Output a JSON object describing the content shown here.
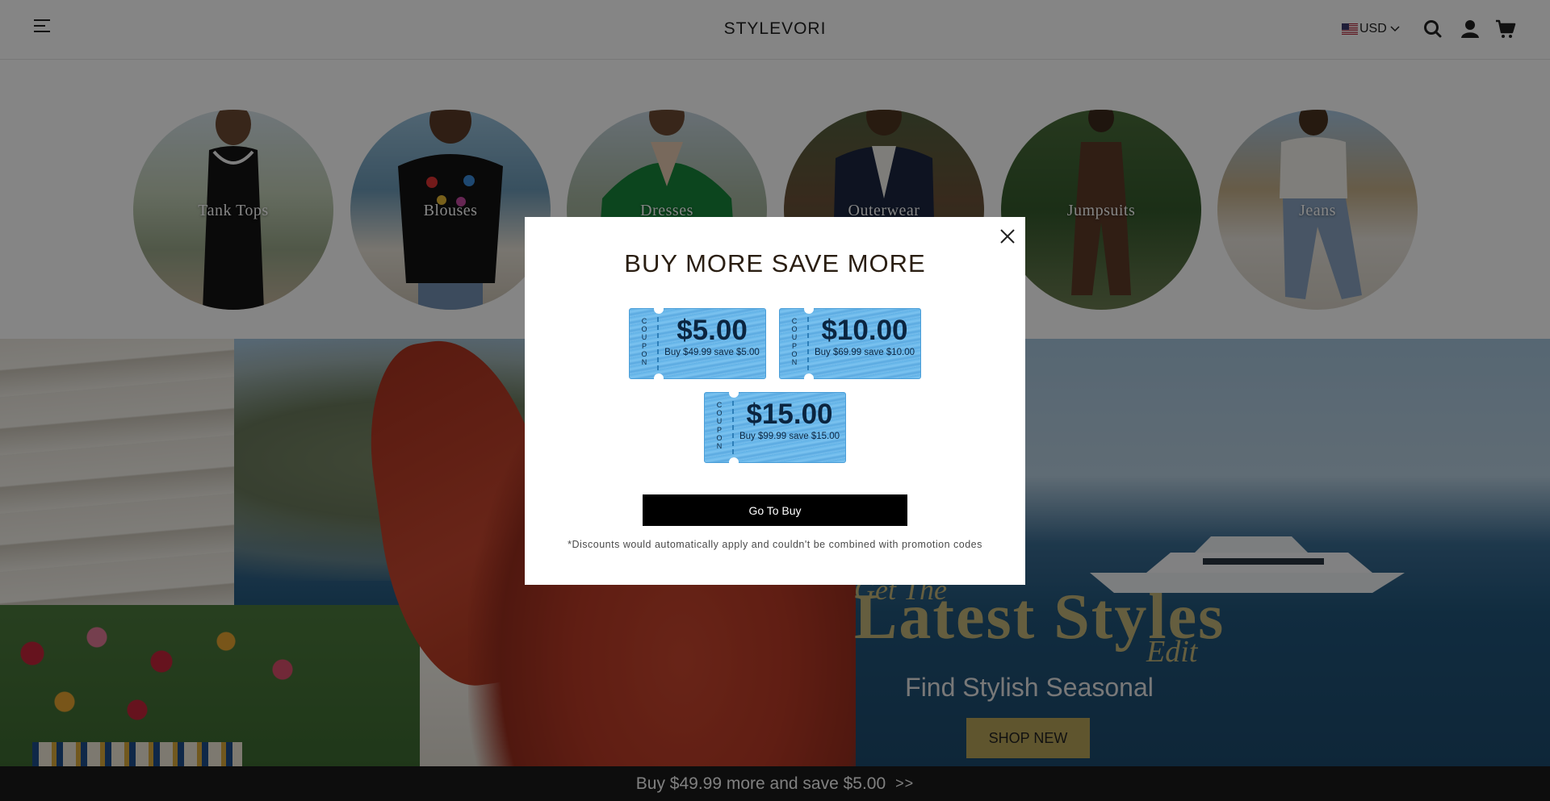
{
  "header": {
    "logo": "STYLEVORI",
    "currency": "USD",
    "icons": [
      "menu-icon",
      "us-flag-icon",
      "chevron-down-icon",
      "search-icon",
      "account-icon",
      "cart-icon"
    ]
  },
  "categories": [
    {
      "label": "Tank Tops"
    },
    {
      "label": "Blouses"
    },
    {
      "label": "Dresses"
    },
    {
      "label": "Outerwear"
    },
    {
      "label": "Jumpsuits"
    },
    {
      "label": "Jeans"
    }
  ],
  "hero": {
    "get_the": "Get The",
    "headline": "Latest Styles",
    "edit": "Edit",
    "subheadline": "Find Stylish Seasonal",
    "cta": "SHOP NEW"
  },
  "bottom_bar": {
    "text": "Buy $49.99 more and save $5.00",
    "arrows": ">>"
  },
  "modal": {
    "title": "BUY MORE SAVE MORE",
    "coupons": [
      {
        "stub": "COUPON",
        "amount": "$5.00",
        "description": "Buy $49.99 save $5.00"
      },
      {
        "stub": "COUPON",
        "amount": "$10.00",
        "description": "Buy $69.99 save $10.00"
      },
      {
        "stub": "COUPON",
        "amount": "$15.00",
        "description": "Buy $99.99 save $15.00"
      }
    ],
    "cta": "Go To Buy",
    "note": "*Discounts would automatically apply and couldn't be combined with promotion codes"
  },
  "colors": {
    "overlay": "#000000",
    "coupon_blue": "#6cb8ea",
    "cta_black": "#000000",
    "hero_gold": "#c2b57a",
    "shop_button": "#b7a458",
    "bottom_bar": "#1a1a1a"
  }
}
